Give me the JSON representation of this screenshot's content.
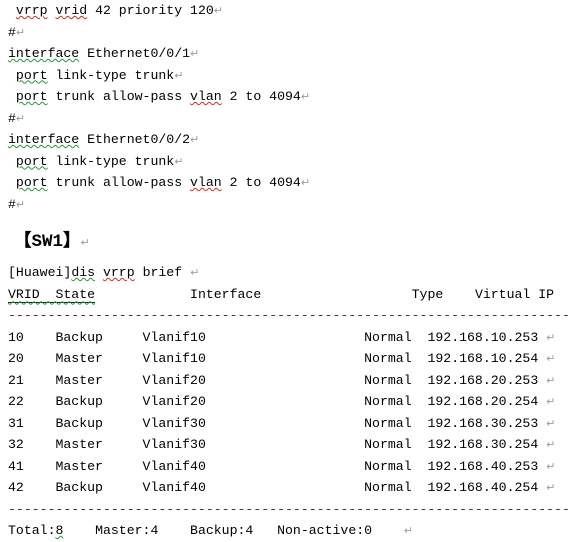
{
  "document": {
    "type": "cli-transcript",
    "return_mark": "↵",
    "config_lines": [
      {
        "indent": 1,
        "tokens": [
          {
            "text": "vrrp",
            "mark": "red"
          },
          {
            "text": " "
          },
          {
            "text": "vrid",
            "mark": "red"
          },
          {
            "text": " 42 priority 120"
          }
        ]
      },
      {
        "indent": 0,
        "tokens": [
          {
            "text": "#"
          }
        ]
      },
      {
        "indent": 0,
        "tokens": [
          {
            "text": "interface",
            "mark": "green"
          },
          {
            "text": " Ethernet0/0/1"
          }
        ]
      },
      {
        "indent": 1,
        "tokens": [
          {
            "text": "port",
            "mark": "green"
          },
          {
            "text": " link-type trunk"
          }
        ]
      },
      {
        "indent": 1,
        "tokens": [
          {
            "text": "port",
            "mark": "green"
          },
          {
            "text": " trunk allow-pass "
          },
          {
            "text": "vlan",
            "mark": "red"
          },
          {
            "text": " 2 to 4094"
          }
        ]
      },
      {
        "indent": 0,
        "tokens": [
          {
            "text": "#"
          }
        ]
      },
      {
        "indent": 0,
        "tokens": [
          {
            "text": "interface",
            "mark": "green"
          },
          {
            "text": " Ethernet0/0/2"
          }
        ]
      },
      {
        "indent": 1,
        "tokens": [
          {
            "text": "port",
            "mark": "green"
          },
          {
            "text": " link-type trunk"
          }
        ]
      },
      {
        "indent": 1,
        "tokens": [
          {
            "text": "port",
            "mark": "green"
          },
          {
            "text": " trunk allow-pass "
          },
          {
            "text": "vlan",
            "mark": "red"
          },
          {
            "text": " 2 to 4094"
          }
        ]
      },
      {
        "indent": 0,
        "tokens": [
          {
            "text": "#"
          }
        ]
      }
    ],
    "section_heading": "【SW1】",
    "command_line": {
      "prompt": "[Huawei]",
      "cmd_abbrev": "dis",
      "cmd_word": "vrrp",
      "cmd_tail": "brief"
    },
    "table": {
      "header_left": "VRID  State",
      "header_cols": [
        "Interface",
        "Type",
        "Virtual IP"
      ],
      "header_raw": "VRID  State      Interface                   Type    Virtual IP   ",
      "separator": "----------------------------------------------------------------------------",
      "columns": [
        "VRID",
        "State",
        "Interface",
        "Type",
        "Virtual IP"
      ],
      "rows": [
        {
          "vrid": "10",
          "state": "Backup",
          "interface": "Vlanif10",
          "type": "Normal",
          "virtual_ip": "192.168.10.253"
        },
        {
          "vrid": "20",
          "state": "Master",
          "interface": "Vlanif10",
          "type": "Normal",
          "virtual_ip": "192.168.10.254"
        },
        {
          "vrid": "21",
          "state": "Master",
          "interface": "Vlanif20",
          "type": "Normal",
          "virtual_ip": "192.168.20.253"
        },
        {
          "vrid": "22",
          "state": "Backup",
          "interface": "Vlanif20",
          "type": "Normal",
          "virtual_ip": "192.168.20.254"
        },
        {
          "vrid": "31",
          "state": "Backup",
          "interface": "Vlanif30",
          "type": "Normal",
          "virtual_ip": "192.168.30.253"
        },
        {
          "vrid": "32",
          "state": "Master",
          "interface": "Vlanif30",
          "type": "Normal",
          "virtual_ip": "192.168.30.254"
        },
        {
          "vrid": "41",
          "state": "Master",
          "interface": "Vlanif40",
          "type": "Normal",
          "virtual_ip": "192.168.40.253"
        },
        {
          "vrid": "42",
          "state": "Backup",
          "interface": "Vlanif40",
          "type": "Normal",
          "virtual_ip": "192.168.40.254"
        }
      ],
      "summary": {
        "total_label": "Total:",
        "total_value": "8",
        "master_label": "Master:4",
        "backup_label": "Backup:4",
        "nonactive_label": "Non-active:0"
      }
    },
    "colors": {
      "text": "#000000",
      "spell_red": "#d42a1f",
      "grammar_green": "#1f9a36",
      "return_mark": "#9a9a9a",
      "rule": "#3a3326"
    }
  }
}
